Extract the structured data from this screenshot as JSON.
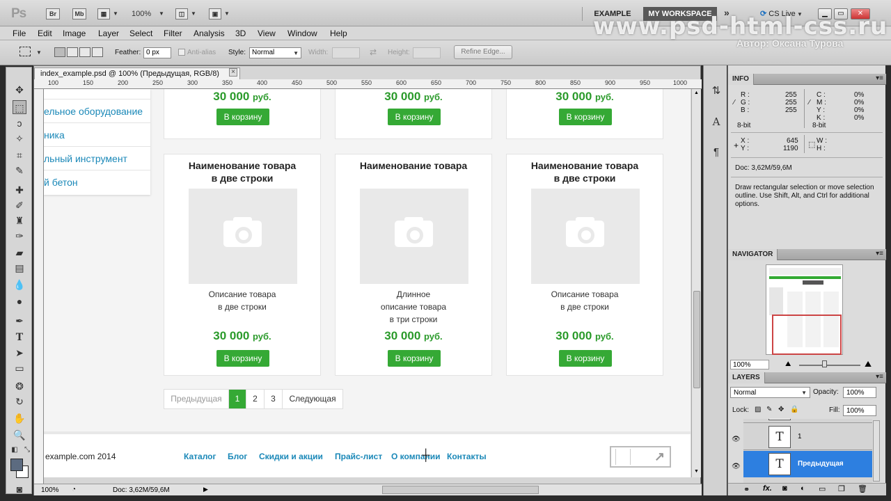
{
  "app": {
    "logo": "Ps",
    "br": "Br",
    "mb": "Mb",
    "zoom": "100%",
    "workspace_example": "EXAMPLE",
    "workspace_active": "MY WORKSPACE",
    "more": "»",
    "cslive": "CS Live",
    "win_min": "▁",
    "win_max": "▭",
    "win_close": "✕"
  },
  "watermark": {
    "site": "www.psd-html-css.ru",
    "author": "Автор: Оксана Турова"
  },
  "menu": [
    "File",
    "Edit",
    "Image",
    "Layer",
    "Select",
    "Filter",
    "Analysis",
    "3D",
    "View",
    "Window",
    "Help"
  ],
  "options": {
    "feather_label": "Feather:",
    "feather_value": "0 px",
    "antialias": "Anti-alias",
    "style_label": "Style:",
    "style_value": "Normal",
    "width_label": "Width:",
    "height_label": "Height:",
    "refine": "Refine Edge..."
  },
  "document": {
    "tab": "index_example.psd @ 100% (Предыдущая, RGB/8)",
    "ruler": [
      "100",
      "150",
      "200",
      "250",
      "300",
      "350",
      "400",
      "450",
      "500",
      "550",
      "600",
      "650",
      "700",
      "750",
      "800",
      "850",
      "900",
      "950",
      "1000"
    ],
    "status_zoom": "100%",
    "status_doc": "Doc: 3,62M/59,6M"
  },
  "site": {
    "sidebar": [
      "ельное оборудование",
      "ника",
      "льный инструмент",
      "й бетон"
    ],
    "top_cards": [
      {
        "price": "30 000",
        "cur": "руб.",
        "btn": "В корзину"
      },
      {
        "price": "30 000",
        "cur": "руб.",
        "btn": "В корзину"
      },
      {
        "price": "30 000",
        "cur": "руб.",
        "btn": "В корзину"
      }
    ],
    "cards": [
      {
        "title1": "Наименование товара",
        "title2": "в две строки",
        "desc": [
          "Описание товара",
          "в две строки"
        ],
        "price": "30 000",
        "cur": "руб.",
        "btn": "В корзину"
      },
      {
        "title1": "Наименование товара",
        "title2": "",
        "desc": [
          "Длинное",
          "описание товара",
          "в три строки"
        ],
        "price": "30 000",
        "cur": "руб.",
        "btn": "В корзину"
      },
      {
        "title1": "Наименование товара",
        "title2": "в две строки",
        "desc": [
          "Описание товара",
          "в две строки"
        ],
        "price": "30 000",
        "cur": "руб.",
        "btn": "В корзину"
      }
    ],
    "pager": {
      "prev": "Предыдущая",
      "p1": "1",
      "p2": "2",
      "p3": "3",
      "next": "Следующая"
    },
    "footer": {
      "copy": "example.com 2014",
      "links": [
        "Каталог",
        "Блог",
        "Скидки и акции",
        "Прайс-лист",
        "О компании",
        "Контакты"
      ]
    }
  },
  "info_panel": {
    "title": "INFO",
    "R": "255",
    "G": "255",
    "B": "255",
    "C": "0%",
    "M": "0%",
    "Y": "0%",
    "K": "0%",
    "bit1": "8-bit",
    "bit2": "8-bit",
    "X": "645",
    "Y_coord": "1190",
    "doc": "Doc: 3,62M/59,6M",
    "hint": "Draw rectangular selection or move selection outline.  Use Shift, Alt, and Ctrl for additional options."
  },
  "navigator": {
    "title": "NAVIGATOR",
    "zoom": "100%"
  },
  "layers": {
    "title": "LAYERS",
    "blend": "Normal",
    "opacity_label": "Opacity:",
    "opacity": "100%",
    "lock_label": "Lock:",
    "fill_label": "Fill:",
    "fill": "100%",
    "items": [
      {
        "name": "1"
      },
      {
        "name": "Предыдущая"
      }
    ]
  },
  "colors": {
    "accent_green": "#35a935",
    "link_blue": "#1a88b8",
    "layer_selected": "#2d7fe0"
  }
}
